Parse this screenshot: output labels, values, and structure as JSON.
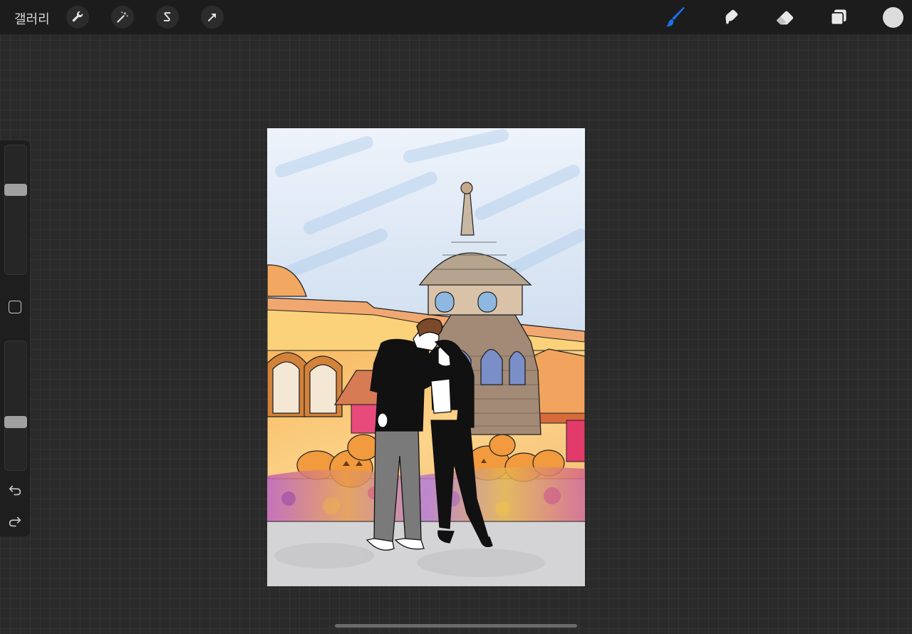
{
  "toolbar": {
    "gallery_label": "갤러리",
    "left_tools": [
      {
        "name": "actions",
        "icon": "wrench-icon"
      },
      {
        "name": "adjustments",
        "icon": "magic-wand-icon"
      },
      {
        "name": "selection",
        "icon": "selection-s-icon"
      },
      {
        "name": "transform",
        "icon": "arrow-cursor-icon"
      }
    ],
    "right_tools": [
      {
        "name": "brush",
        "icon": "brush-icon",
        "active": true,
        "color": "#1a73e8"
      },
      {
        "name": "smudge",
        "icon": "smudge-icon"
      },
      {
        "name": "eraser",
        "icon": "eraser-icon"
      },
      {
        "name": "layers",
        "icon": "layers-icon"
      }
    ],
    "current_color": "#dcdcdc"
  },
  "sidebar": {
    "brush_size_level": 0.33,
    "opacity_level": 0.64,
    "modify_button_icon": "square-icon",
    "undo_icon": "undo-icon",
    "redo_icon": "redo-icon"
  },
  "canvas": {
    "artwork": "illustration-couple-halloween"
  },
  "colors": {
    "background": "#2a2a2a",
    "toolbar": "#1c1c1c",
    "active_tool": "#1a73e8"
  }
}
